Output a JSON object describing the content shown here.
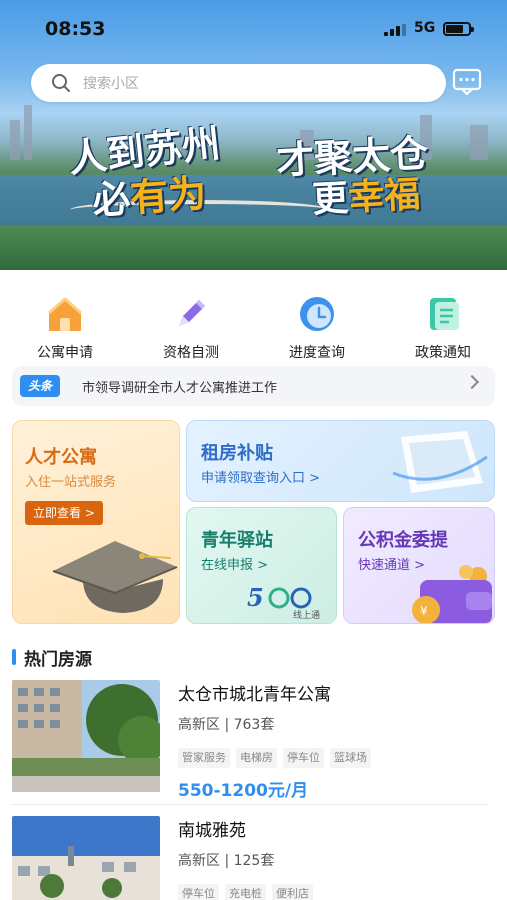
{
  "status_bar": {
    "time": "08:53",
    "network": "5G",
    "battery_level": 0.75
  },
  "search": {
    "placeholder": "搜索小区"
  },
  "banner": {
    "slogan_left_line1": "人到苏州",
    "slogan_left_line2_a": "必",
    "slogan_left_line2_b": "有为",
    "slogan_right_line1": "才聚太仓",
    "slogan_right_line2_a": "更",
    "slogan_right_line2_b": "幸福"
  },
  "quick_actions": [
    {
      "label": "公寓申请",
      "icon": "house-icon"
    },
    {
      "label": "资格自测",
      "icon": "pencil-icon"
    },
    {
      "label": "进度查询",
      "icon": "clock-icon"
    },
    {
      "label": "政策通知",
      "icon": "document-icon"
    }
  ],
  "notice": {
    "tag": "头条",
    "text": "市领导调研全市人才公寓推进工作"
  },
  "cards": {
    "talent_apartment": {
      "title": "人才公寓",
      "subtitle": "入住一站式服务",
      "button": "立即查看 >"
    },
    "rent_subsidy": {
      "title": "租房补贴",
      "subtitle": "申请领取查询入口 >"
    },
    "youth_station": {
      "title": "青年驿站",
      "subtitle": "在线申报 >",
      "logo_text": "线上通"
    },
    "provident_fund": {
      "title": "公积金委提",
      "subtitle": "快速通道 >"
    }
  },
  "section_title": "热门房源",
  "listings": [
    {
      "name": "太仓市城北青年公寓",
      "district": "高新区 | 763套",
      "tags": [
        "管家服务",
        "电梯房",
        "停车位",
        "篮球场"
      ],
      "price": "550-1200元/月"
    },
    {
      "name": "南城雅苑",
      "district": "高新区 | 125套",
      "tags": [
        "停车位",
        "充电桩",
        "便利店"
      ],
      "price": ""
    }
  ],
  "colors": {
    "accent": "#2f8ef0",
    "orange": "#d9650f",
    "green": "#17806a",
    "purple": "#6538b8"
  }
}
